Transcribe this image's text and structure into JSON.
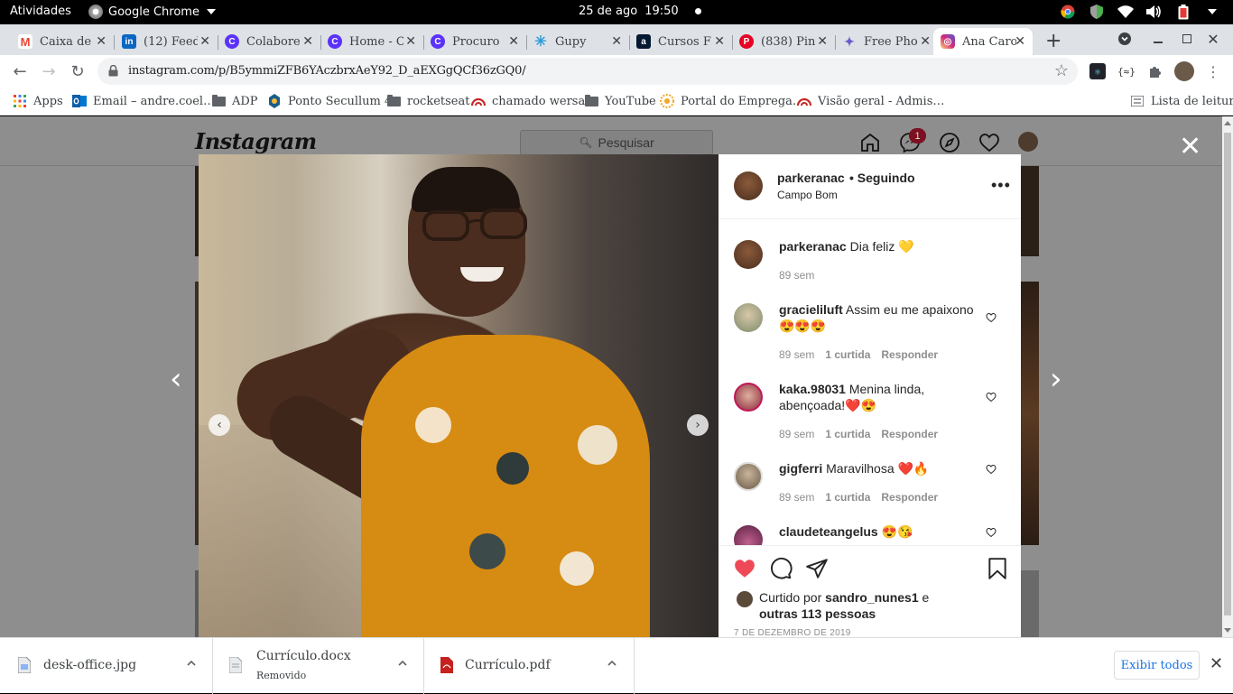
{
  "system_bar": {
    "activities": "Atividades",
    "app_name": "Google Chrome",
    "date": "25 de ago",
    "time": "19:50"
  },
  "tabs": [
    {
      "title": "Caixa de",
      "icon": "gmail-icon",
      "color": "#ea4335",
      "glyph": "M"
    },
    {
      "title": "(12) Feed",
      "icon": "linkedin-icon",
      "color": "#0a66c2",
      "glyph": "in"
    },
    {
      "title": "Colabore",
      "icon": "canva-icon",
      "color": "#5a32fa",
      "glyph": "C"
    },
    {
      "title": "Home - C",
      "icon": "canva-icon",
      "color": "#5a32fa",
      "glyph": "C"
    },
    {
      "title": "Procuro",
      "icon": "canva-icon",
      "color": "#5a32fa",
      "glyph": "C"
    },
    {
      "title": "Gupy",
      "icon": "gupy-icon",
      "color": "#2d9cdb",
      "glyph": "✳"
    },
    {
      "title": "Cursos F",
      "icon": "alura-icon",
      "color": "#051933",
      "glyph": "a"
    },
    {
      "title": "(838) Pin",
      "icon": "pinterest-icon",
      "color": "#e60023",
      "glyph": "P"
    },
    {
      "title": "Free Phot",
      "icon": "freepik-icon",
      "color": "#6a5acd",
      "glyph": "✦"
    },
    {
      "title": "Ana Caro",
      "icon": "instagram-icon",
      "color": "#d6249f",
      "glyph": "◎"
    }
  ],
  "toolbar": {
    "url": "instagram.com/p/B5ymmiZFB6YAczbrxAeY92_D_aEXGgQCf36zGQ0/"
  },
  "bookmarks": [
    {
      "label": "Apps",
      "icon": "apps-grid-icon"
    },
    {
      "label": "Email – andre.coel…",
      "icon": "outlook-icon"
    },
    {
      "label": "ADP",
      "icon": "folder-icon"
    },
    {
      "label": "Ponto Secullum 4",
      "icon": "secullum-icon"
    },
    {
      "label": "rocketseat",
      "icon": "folder-icon"
    },
    {
      "label": "chamado wersa",
      "icon": "wersa-icon"
    },
    {
      "label": "YouTube",
      "icon": "folder-icon"
    },
    {
      "label": "Portal do Emprega…",
      "icon": "portal-icon"
    },
    {
      "label": "Visão geral - Admis…",
      "icon": "wersa-icon"
    }
  ],
  "reading_list": "Lista de leitura",
  "instagram": {
    "logo": "Instagram",
    "search_placeholder": "Pesquisar",
    "messages_badge": "1"
  },
  "post": {
    "author": "parkeranac",
    "follow_status": "• Seguindo",
    "location": "Campo Bom",
    "caption": {
      "user": "parkeranac",
      "text": " Dia feliz 💛",
      "age": "89 sem"
    },
    "comments": [
      {
        "user": "gracieliluft",
        "text": " Assim eu me apaixono 😍😍😍",
        "age": "89 sem",
        "likes": "1 curtida",
        "reply": "Responder"
      },
      {
        "user": "kaka.98031",
        "text": " Menina linda, abençoada!❤️😍",
        "age": "89 sem",
        "likes": "1 curtida",
        "reply": "Responder"
      },
      {
        "user": "gigferri",
        "text": " Maravilhosa ❤️🔥",
        "age": "89 sem",
        "likes": "1 curtida",
        "reply": "Responder"
      },
      {
        "user": "claudeteangelus",
        "text": " 😍😘",
        "age": "",
        "likes": "",
        "reply": ""
      }
    ],
    "liked_by_prefix": "Curtido por ",
    "liked_by_user": "sandro_nunes1",
    "liked_by_suffix": " e",
    "liked_by_others": "outras 113 pessoas",
    "date": "7 DE DEZEMBRO DE 2019",
    "liked": true
  },
  "downloads": [
    {
      "name": "desk-office.jpg",
      "status": ""
    },
    {
      "name": "Currículo.docx",
      "status": "Removido"
    },
    {
      "name": "Currículo.pdf",
      "status": ""
    }
  ],
  "downloads_show_all": "Exibir todos",
  "colors": {
    "like_red": "#ed4956",
    "link_blue": "#1a73e8"
  }
}
